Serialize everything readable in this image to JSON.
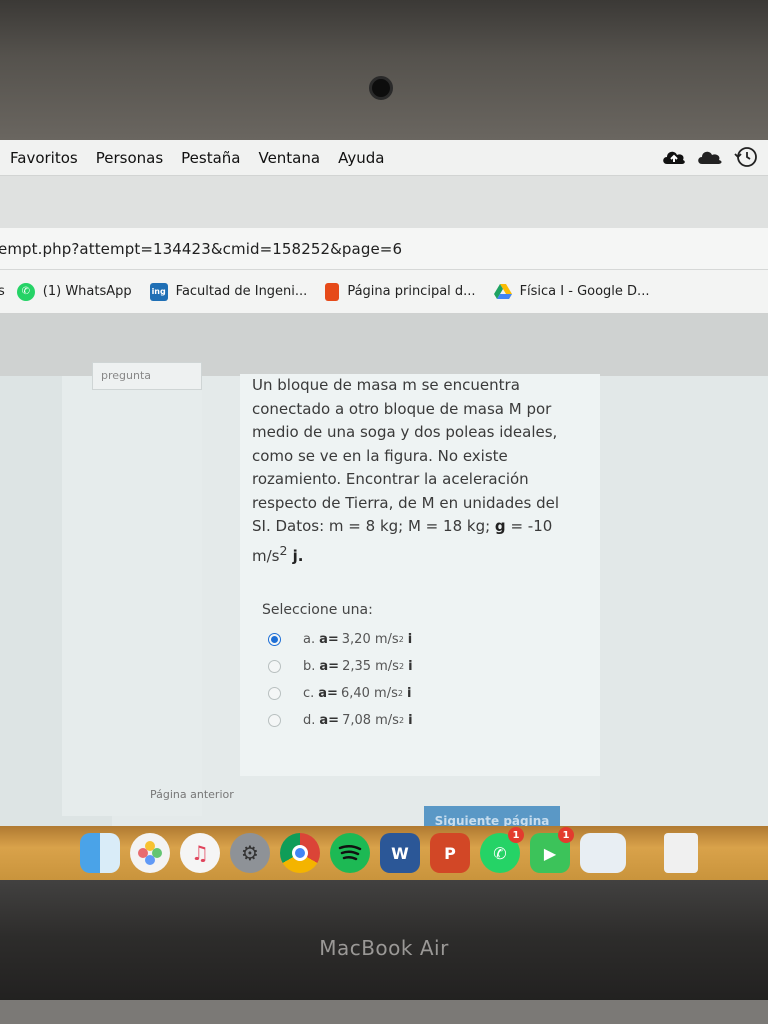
{
  "device": {
    "brand": "MacBook Air"
  },
  "menubar": {
    "items": [
      "Favoritos",
      "Personas",
      "Pestaña",
      "Ventana",
      "Ayuda"
    ],
    "icons": [
      "cloud-upload-icon",
      "cloud-icon",
      "time-machine-icon"
    ]
  },
  "browser": {
    "url": "empt.php?attempt=134423&cmid=158252&page=6",
    "bookmarks": [
      {
        "label": "s",
        "icon": "truncated"
      },
      {
        "label": "(1) WhatsApp",
        "icon": "whatsapp-icon"
      },
      {
        "label": "Facultad de Ingeni...",
        "icon": "ing-icon"
      },
      {
        "label": "Página principal d...",
        "icon": "office-icon"
      },
      {
        "label": "Física I - Google D...",
        "icon": "google-drive-icon"
      }
    ]
  },
  "quiz": {
    "pregunta_tab": "pregunta",
    "question_text": "Un bloque de masa m se encuentra conectado a otro bloque de masa M por medio de una soga y dos poleas ideales, como se ve en la figura. No existe rozamiento. Encontrar la aceleración respecto de Tierra, de M en unidades del SI. Datos: m = 8 kg; M = 18 kg; ",
    "g_label": "g",
    "g_value": " = -10",
    "g_unit": "m/s",
    "g_unit_sup": "2",
    "g_vector": " j.",
    "select_label": "Seleccione una:",
    "options": [
      {
        "letter": "a.",
        "label": "a=",
        "value": "3,20 m/s",
        "sup": "2",
        "vec": "i",
        "checked": true
      },
      {
        "letter": "b.",
        "label": "a=",
        "value": "2,35 m/s",
        "sup": "2",
        "vec": "i",
        "checked": false
      },
      {
        "letter": "c.",
        "label": "a=",
        "value": "6,40 m/s",
        "sup": "2",
        "vec": "i",
        "checked": false
      },
      {
        "letter": "d.",
        "label": "a=",
        "value": "7,08 m/s",
        "sup": "2",
        "vec": "i",
        "checked": false
      }
    ],
    "prev_label": "Página anterior",
    "next_label": "Siguiente página"
  },
  "dock": {
    "apps": [
      "finder-icon",
      "photos-icon",
      "itunes-icon",
      "system-preferences-icon",
      "chrome-icon",
      "spotify-icon",
      "word-icon",
      "powerpoint-icon",
      "whatsapp-icon",
      "facetime-icon",
      "preview-icon",
      "trash-icon"
    ],
    "badges": {
      "whatsapp": "1",
      "facetime": "1"
    },
    "word_letter": "W",
    "powerpoint_letter": "P"
  }
}
